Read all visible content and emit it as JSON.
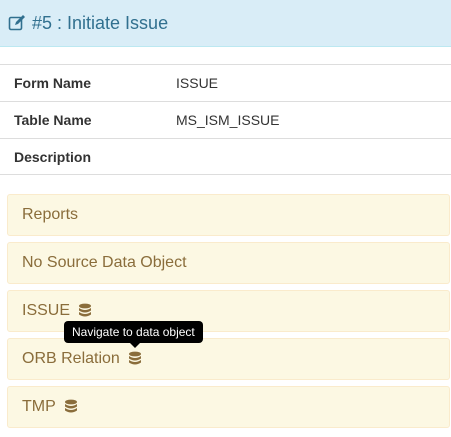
{
  "header": {
    "title": "#5 : Initiate Issue",
    "icon": "edit-icon",
    "color": "#31708f"
  },
  "info": {
    "rows": [
      {
        "label": "Form Name",
        "value": "ISSUE"
      },
      {
        "label": "Table Name",
        "value": "MS_ISM_ISSUE"
      },
      {
        "label": "Description",
        "value": ""
      }
    ]
  },
  "panels": [
    {
      "label": "Reports",
      "icon": ""
    },
    {
      "label": "No Source Data Object",
      "icon": ""
    },
    {
      "label": "ISSUE",
      "icon": "database-icon"
    },
    {
      "label": "ORB Relation",
      "icon": "database-icon"
    },
    {
      "label": "TMP",
      "icon": "database-icon"
    }
  ],
  "tooltip": {
    "text": "Navigate to data object"
  },
  "colors": {
    "panel_bg": "#fcf8e3",
    "panel_text": "#8a6d3b",
    "header_bg": "#d9edf7"
  }
}
